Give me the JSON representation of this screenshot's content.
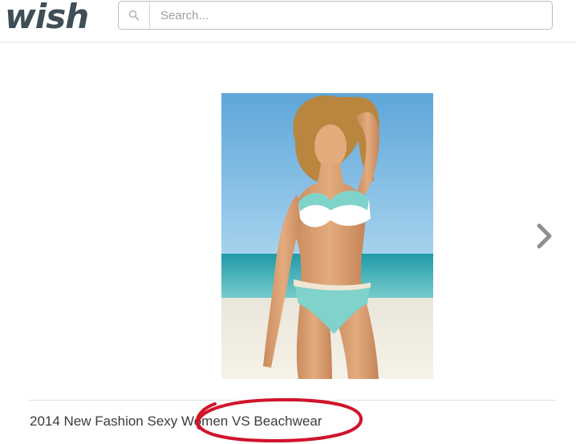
{
  "header": {
    "logo_text": "wish",
    "search": {
      "placeholder": "Search...",
      "value": ""
    }
  },
  "product": {
    "title": "2014 New Fashion Sexy Women VS Beachwear",
    "next_icon": "chevron-right-icon"
  },
  "colors": {
    "logo": "#3f4e57",
    "annotation_circle": "#d0142a"
  }
}
